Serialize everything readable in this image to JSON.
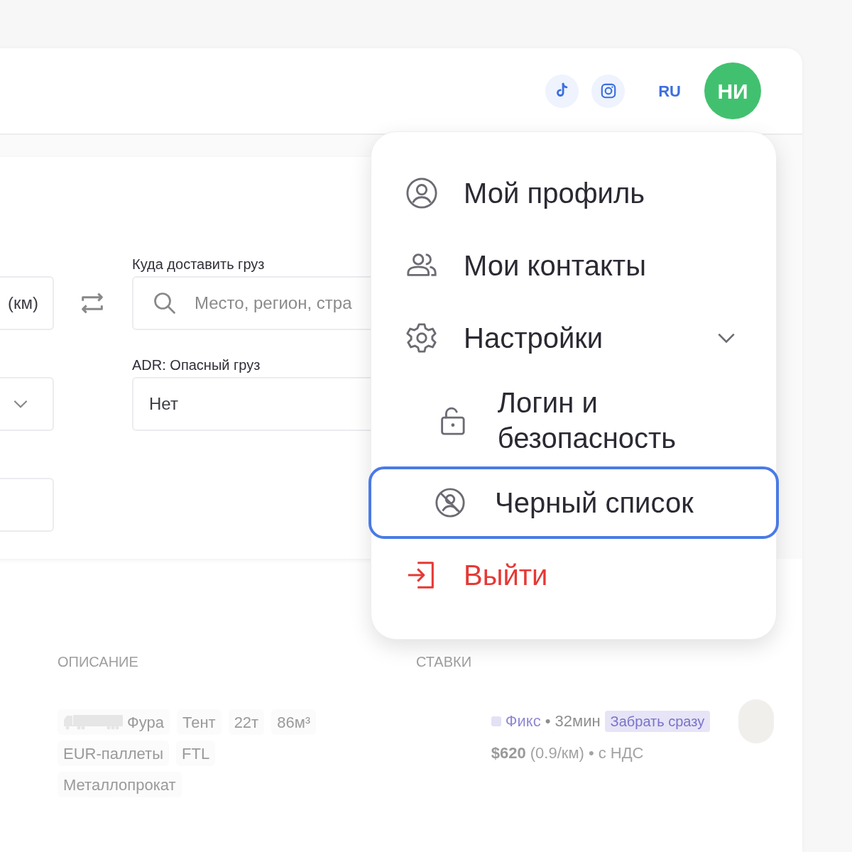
{
  "header": {
    "social": [
      {
        "kind": "tiktok"
      },
      {
        "kind": "instagram"
      }
    ],
    "language": {
      "label": "RU",
      "selected": true
    },
    "user_initials": "НИ"
  },
  "form": {
    "rows": [
      {
        "left": {
          "kind": "text",
          "value": "(км)"
        },
        "right": {
          "label": "Куда доставить груз",
          "kind": "search",
          "placeholder": "Место, регион, стра"
        }
      },
      {
        "left": {
          "kind": "select"
        },
        "right": {
          "label": "ADR: Опасный груз",
          "kind": "text",
          "value": "Нет"
        }
      },
      {
        "left": {
          "kind": "text"
        }
      }
    ]
  },
  "user_menu": {
    "items": [
      {
        "kind": "item",
        "label": "Мой профиль",
        "selected": false
      },
      {
        "kind": "item",
        "label": "Мои контакты",
        "selected": false
      },
      {
        "kind": "group",
        "label": "Настройки",
        "expanded": true,
        "selected": false,
        "children": [
          {
            "kind": "subitem",
            "label": "Логин и безопасность",
            "selected": false
          },
          {
            "kind": "subitem",
            "label": "Черный список",
            "selected": true
          }
        ]
      },
      {
        "kind": "danger",
        "label": "Выйти",
        "selected": false
      }
    ]
  },
  "results": {
    "columns": [
      "ОПИСАНИЕ",
      "СТАВКИ"
    ],
    "rows": [
      {
        "tags": [
          {
            "kind": "truck",
            "label": "Фура"
          },
          {
            "kind": "text",
            "label": "Тент"
          },
          {
            "kind": "text",
            "label": "22т"
          },
          {
            "kind": "text",
            "label": "86м³"
          },
          {
            "kind": "text",
            "label": "EUR-паллеты"
          },
          {
            "kind": "text",
            "label": "FTL"
          },
          {
            "kind": "text",
            "label": "Металлопрокат"
          }
        ],
        "rate": {
          "type": "Фикс",
          "color": "#e3e1f5",
          "time": "• 32мин",
          "badge": "Забрать сразу",
          "price": "$620",
          "per_km": "(0.9/км)",
          "vat": "• с НДС"
        }
      }
    ]
  }
}
